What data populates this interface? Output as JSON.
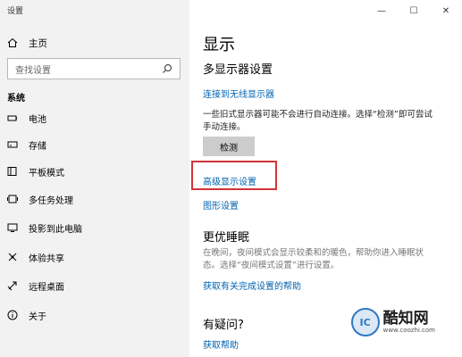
{
  "window": {
    "title": "设置",
    "controls": {
      "minimize": "—",
      "maximize": "☐",
      "close": "✕"
    }
  },
  "sidebar": {
    "home_label": "主页",
    "search_placeholder": "查找设置",
    "section": "系统",
    "items": [
      {
        "label": "电池",
        "icon": "battery-icon"
      },
      {
        "label": "存储",
        "icon": "storage-icon"
      },
      {
        "label": "平板模式",
        "icon": "tablet-mode-icon"
      },
      {
        "label": "多任务处理",
        "icon": "multitasking-icon"
      },
      {
        "label": "投影到此电脑",
        "icon": "project-icon"
      },
      {
        "label": "体验共享",
        "icon": "shared-experiences-icon"
      },
      {
        "label": "远程桌面",
        "icon": "remote-desktop-icon"
      },
      {
        "label": "关于",
        "icon": "info-icon"
      }
    ]
  },
  "main": {
    "title": "显示",
    "multi_display": {
      "heading": "多显示器设置",
      "wireless_link": "连接到无线显示器",
      "desc_line1": "一些旧式显示器可能不会进行自动连接。选择“检测”即可尝试",
      "desc_line2": "手动连接。",
      "detect_button": "检测",
      "advanced_link": "高级显示设置",
      "graphics_link": "图形设置"
    },
    "sleep": {
      "heading": "更优睡眠",
      "desc_line1": "在晚间，夜间模式会显示较柔和的暖色，帮助你进入睡眠状",
      "desc_line2": "态。选择“夜间模式设置”进行设置。",
      "help_link": "获取有关完成设置的帮助"
    },
    "faq": {
      "heading": "有疑问?",
      "help_link": "获取帮助"
    }
  },
  "watermark": {
    "logo": "IC",
    "brand": "酷知网",
    "url": "www.coozhi.com"
  }
}
